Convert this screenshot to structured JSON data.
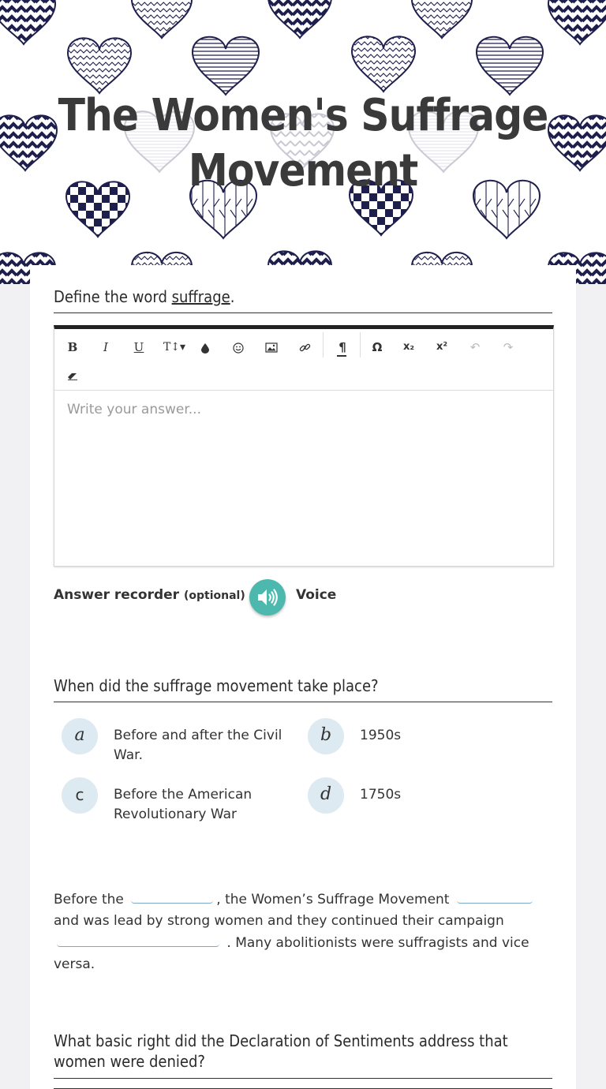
{
  "header": {
    "title_line1": "The Women's Suffrage",
    "title_line2": "Movement",
    "heart_color": "#1f1f4d"
  },
  "q1": {
    "prefix": "Define the word ",
    "keyword": "suffrage",
    "suffix": ".",
    "placeholder": "Write your answer...",
    "toolbar": {
      "bold": "B",
      "italic": "I",
      "underline": "U",
      "text_size": "T↕▾",
      "color_icon": "droplet-icon",
      "emoji_icon": "smiley-icon",
      "image_icon": "image-icon",
      "link_icon": "link-icon",
      "paragraph": "¶",
      "omega": "Ω",
      "subscript": "x₂",
      "superscript": "x²",
      "undo": "↶",
      "redo": "↷",
      "eraser_icon": "eraser-icon"
    },
    "recorder_label": "Answer recorder",
    "recorder_optional": "(optional)",
    "recorder_dash": "-",
    "voice_label": "Voice"
  },
  "q2": {
    "title": "When did the suffrage movement take place?",
    "options": [
      {
        "letter": "a",
        "text": "Before and after the Civil War."
      },
      {
        "letter": "b",
        "text": "1950s"
      },
      {
        "letter": "c",
        "text": "Before the American Revolutionary War"
      },
      {
        "letter": "d",
        "text": "1750s"
      }
    ]
  },
  "q3": {
    "part1": "Before the",
    "part2": ", the Women’s Suffrage Movement",
    "part3": "and was lead by strong women and they continued their campaign",
    "part4": ". Many abolitionists were suffragists and vice versa."
  },
  "q4": {
    "title": "What basic right did the Declaration of Sentiments address that women were denied?"
  }
}
